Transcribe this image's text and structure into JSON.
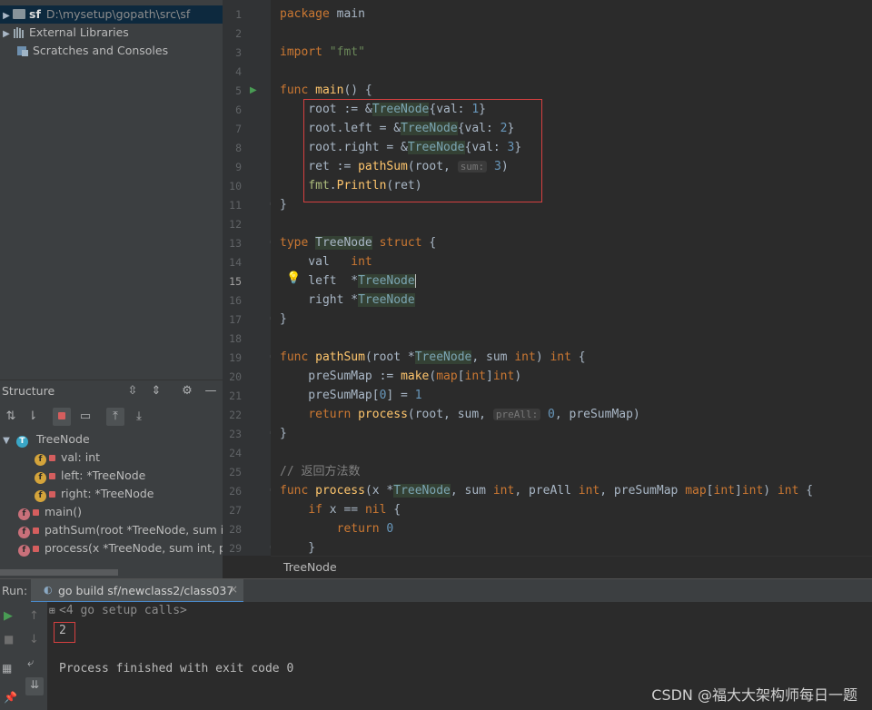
{
  "project": {
    "root_name": "sf",
    "root_path": "D:\\mysetup\\gopath\\src\\sf",
    "external_libraries": "External Libraries",
    "scratches": "Scratches and Consoles"
  },
  "structure": {
    "title": "Structure",
    "items": [
      {
        "badge": "T",
        "label": "TreeNode"
      },
      {
        "badge": "f",
        "label": "val: int"
      },
      {
        "badge": "f",
        "label": "left: *TreeNode"
      },
      {
        "badge": "f",
        "label": "right: *TreeNode"
      },
      {
        "badge": "f",
        "label": "main()"
      },
      {
        "badge": "f",
        "label": "pathSum(root *TreeNode, sum in"
      },
      {
        "badge": "f",
        "label": "process(x *TreeNode, sum int, pr"
      }
    ]
  },
  "editor": {
    "line_numbers": [
      "1",
      "2",
      "3",
      "4",
      "5",
      "6",
      "7",
      "8",
      "9",
      "10",
      "11",
      "12",
      "13",
      "14",
      "15",
      "16",
      "17",
      "18",
      "19",
      "20",
      "21",
      "22",
      "23",
      "24",
      "25",
      "26",
      "27",
      "28",
      "29"
    ],
    "current_line": "15",
    "breadcrumb": "TreeNode",
    "hints": {
      "sum": "sum:",
      "preAll": "preAll:"
    },
    "comment": "// 返回方法数"
  },
  "run": {
    "label": "Run:",
    "tab": "go build sf/newclass2/class037",
    "setup_calls": "<4 go setup calls>",
    "output": "2",
    "finished": "Process finished with exit code 0"
  },
  "watermark": "CSDN @福大大架构师每日一题",
  "colors": {
    "keyword": "#cc7832",
    "string": "#6a8759",
    "number": "#6897bb",
    "function": "#ffc66d",
    "highlight_box": "#d64040"
  }
}
